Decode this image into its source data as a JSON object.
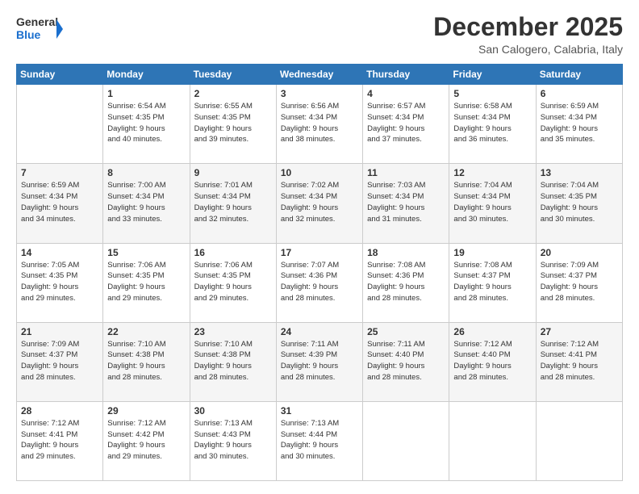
{
  "logo": {
    "line1": "General",
    "line2": "Blue"
  },
  "title": "December 2025",
  "location": "San Calogero, Calabria, Italy",
  "weekdays": [
    "Sunday",
    "Monday",
    "Tuesday",
    "Wednesday",
    "Thursday",
    "Friday",
    "Saturday"
  ],
  "weeks": [
    [
      {
        "day": "",
        "info": ""
      },
      {
        "day": "1",
        "info": "Sunrise: 6:54 AM\nSunset: 4:35 PM\nDaylight: 9 hours\nand 40 minutes."
      },
      {
        "day": "2",
        "info": "Sunrise: 6:55 AM\nSunset: 4:35 PM\nDaylight: 9 hours\nand 39 minutes."
      },
      {
        "day": "3",
        "info": "Sunrise: 6:56 AM\nSunset: 4:34 PM\nDaylight: 9 hours\nand 38 minutes."
      },
      {
        "day": "4",
        "info": "Sunrise: 6:57 AM\nSunset: 4:34 PM\nDaylight: 9 hours\nand 37 minutes."
      },
      {
        "day": "5",
        "info": "Sunrise: 6:58 AM\nSunset: 4:34 PM\nDaylight: 9 hours\nand 36 minutes."
      },
      {
        "day": "6",
        "info": "Sunrise: 6:59 AM\nSunset: 4:34 PM\nDaylight: 9 hours\nand 35 minutes."
      }
    ],
    [
      {
        "day": "7",
        "info": "Sunrise: 6:59 AM\nSunset: 4:34 PM\nDaylight: 9 hours\nand 34 minutes."
      },
      {
        "day": "8",
        "info": "Sunrise: 7:00 AM\nSunset: 4:34 PM\nDaylight: 9 hours\nand 33 minutes."
      },
      {
        "day": "9",
        "info": "Sunrise: 7:01 AM\nSunset: 4:34 PM\nDaylight: 9 hours\nand 32 minutes."
      },
      {
        "day": "10",
        "info": "Sunrise: 7:02 AM\nSunset: 4:34 PM\nDaylight: 9 hours\nand 32 minutes."
      },
      {
        "day": "11",
        "info": "Sunrise: 7:03 AM\nSunset: 4:34 PM\nDaylight: 9 hours\nand 31 minutes."
      },
      {
        "day": "12",
        "info": "Sunrise: 7:04 AM\nSunset: 4:34 PM\nDaylight: 9 hours\nand 30 minutes."
      },
      {
        "day": "13",
        "info": "Sunrise: 7:04 AM\nSunset: 4:35 PM\nDaylight: 9 hours\nand 30 minutes."
      }
    ],
    [
      {
        "day": "14",
        "info": "Sunrise: 7:05 AM\nSunset: 4:35 PM\nDaylight: 9 hours\nand 29 minutes."
      },
      {
        "day": "15",
        "info": "Sunrise: 7:06 AM\nSunset: 4:35 PM\nDaylight: 9 hours\nand 29 minutes."
      },
      {
        "day": "16",
        "info": "Sunrise: 7:06 AM\nSunset: 4:35 PM\nDaylight: 9 hours\nand 29 minutes."
      },
      {
        "day": "17",
        "info": "Sunrise: 7:07 AM\nSunset: 4:36 PM\nDaylight: 9 hours\nand 28 minutes."
      },
      {
        "day": "18",
        "info": "Sunrise: 7:08 AM\nSunset: 4:36 PM\nDaylight: 9 hours\nand 28 minutes."
      },
      {
        "day": "19",
        "info": "Sunrise: 7:08 AM\nSunset: 4:37 PM\nDaylight: 9 hours\nand 28 minutes."
      },
      {
        "day": "20",
        "info": "Sunrise: 7:09 AM\nSunset: 4:37 PM\nDaylight: 9 hours\nand 28 minutes."
      }
    ],
    [
      {
        "day": "21",
        "info": "Sunrise: 7:09 AM\nSunset: 4:37 PM\nDaylight: 9 hours\nand 28 minutes."
      },
      {
        "day": "22",
        "info": "Sunrise: 7:10 AM\nSunset: 4:38 PM\nDaylight: 9 hours\nand 28 minutes."
      },
      {
        "day": "23",
        "info": "Sunrise: 7:10 AM\nSunset: 4:38 PM\nDaylight: 9 hours\nand 28 minutes."
      },
      {
        "day": "24",
        "info": "Sunrise: 7:11 AM\nSunset: 4:39 PM\nDaylight: 9 hours\nand 28 minutes."
      },
      {
        "day": "25",
        "info": "Sunrise: 7:11 AM\nSunset: 4:40 PM\nDaylight: 9 hours\nand 28 minutes."
      },
      {
        "day": "26",
        "info": "Sunrise: 7:12 AM\nSunset: 4:40 PM\nDaylight: 9 hours\nand 28 minutes."
      },
      {
        "day": "27",
        "info": "Sunrise: 7:12 AM\nSunset: 4:41 PM\nDaylight: 9 hours\nand 28 minutes."
      }
    ],
    [
      {
        "day": "28",
        "info": "Sunrise: 7:12 AM\nSunset: 4:41 PM\nDaylight: 9 hours\nand 29 minutes."
      },
      {
        "day": "29",
        "info": "Sunrise: 7:12 AM\nSunset: 4:42 PM\nDaylight: 9 hours\nand 29 minutes."
      },
      {
        "day": "30",
        "info": "Sunrise: 7:13 AM\nSunset: 4:43 PM\nDaylight: 9 hours\nand 30 minutes."
      },
      {
        "day": "31",
        "info": "Sunrise: 7:13 AM\nSunset: 4:44 PM\nDaylight: 9 hours\nand 30 minutes."
      },
      {
        "day": "",
        "info": ""
      },
      {
        "day": "",
        "info": ""
      },
      {
        "day": "",
        "info": ""
      }
    ]
  ]
}
